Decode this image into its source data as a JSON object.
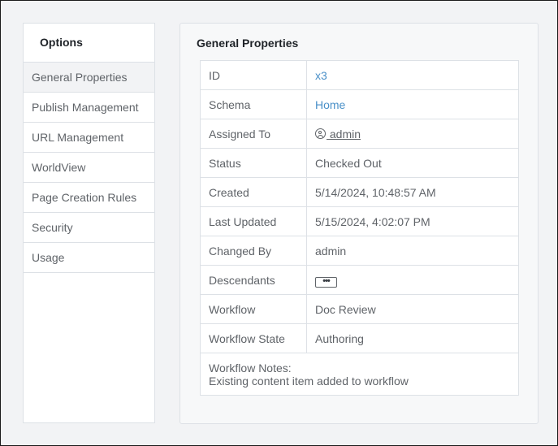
{
  "sidebar": {
    "title": "Options",
    "items": [
      {
        "label": "General Properties",
        "active": true
      },
      {
        "label": "Publish Management"
      },
      {
        "label": "URL Management"
      },
      {
        "label": "WorldView"
      },
      {
        "label": "Page Creation Rules"
      },
      {
        "label": "Security"
      },
      {
        "label": "Usage"
      }
    ]
  },
  "panel": {
    "title": "General Properties",
    "rows": {
      "id": {
        "label": "ID",
        "value": "x3"
      },
      "schema": {
        "label": "Schema",
        "value": "Home"
      },
      "assigned_to": {
        "label": "Assigned To",
        "value": " admin",
        "icon": "user-circle-icon"
      },
      "status": {
        "label": "Status",
        "value": "Checked Out"
      },
      "created": {
        "label": "Created",
        "value": "5/14/2024, 10:48:57 AM"
      },
      "last_updated": {
        "label": "Last Updated",
        "value": "5/15/2024, 4:02:07 PM"
      },
      "changed_by": {
        "label": "Changed By",
        "value": "admin"
      },
      "descendants": {
        "label": "Descendants",
        "button": "•••"
      },
      "workflow": {
        "label": "Workflow",
        "value": "Doc Review"
      },
      "workflow_state": {
        "label": "Workflow State",
        "value": "Authoring"
      }
    },
    "notes": {
      "label": "Workflow Notes:",
      "value": "Existing content item added to workflow"
    }
  }
}
